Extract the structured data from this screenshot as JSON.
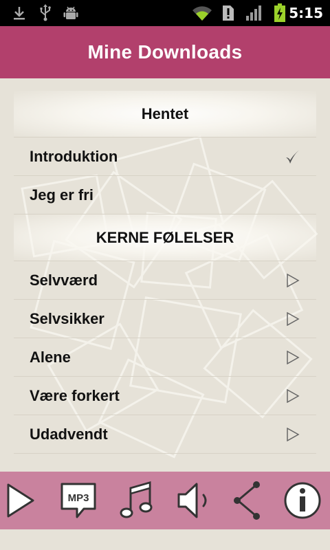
{
  "status_bar": {
    "time": "5:15",
    "icons": [
      "download-icon",
      "usb-icon",
      "android-debug-icon",
      "wifi-icon",
      "alert-icon",
      "signal-icon",
      "battery-charging-icon"
    ]
  },
  "header": {
    "title": "Mine Downloads"
  },
  "list": {
    "section_downloaded": "Hentet",
    "downloaded_items": [
      {
        "label": "Introduktion",
        "status_icon": "checkmark-icon"
      },
      {
        "label": "Jeg er fri",
        "status_icon": ""
      }
    ],
    "section_core": "KERNE FØLELSER",
    "core_items": [
      {
        "label": "Selvværd",
        "status_icon": "play-icon"
      },
      {
        "label": "Selvsikker",
        "status_icon": "play-icon"
      },
      {
        "label": "Alene",
        "status_icon": "play-icon"
      },
      {
        "label": "Være forkert",
        "status_icon": "play-icon"
      },
      {
        "label": "Udadvendt",
        "status_icon": "play-icon"
      }
    ]
  },
  "toolbar": {
    "buttons": [
      "play-icon",
      "mp3-icon",
      "music-note-icon",
      "volume-icon",
      "share-icon",
      "info-icon"
    ],
    "mp3_label": "MP3"
  },
  "colors": {
    "header": "#b2406c",
    "toolbar": "#c9829e",
    "background": "#e6e2d8"
  }
}
